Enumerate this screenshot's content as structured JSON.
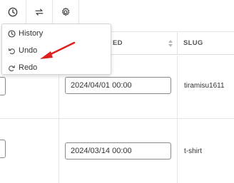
{
  "toolbar": {
    "icons": [
      "clock-icon",
      "sync-icon",
      "gear-icon"
    ]
  },
  "menu": {
    "items": [
      {
        "label": "History",
        "icon": "clock-icon"
      },
      {
        "label": "Undo",
        "icon": "undo-icon"
      },
      {
        "label": "Redo",
        "icon": "redo-icon"
      }
    ]
  },
  "table": {
    "columns": [
      "PUBLISHED",
      "SLUG"
    ],
    "header_visible": {
      "published_tail": "ED",
      "slug": "SLUG"
    },
    "rows": [
      {
        "published": "2024/04/01 00:00",
        "slug": "tiramisu1611"
      },
      {
        "published": "2024/03/14 00:00",
        "slug": "t-shirt"
      }
    ]
  },
  "colors": {
    "annotation_arrow": "#e02020",
    "input_border": "#8a8a8a"
  }
}
